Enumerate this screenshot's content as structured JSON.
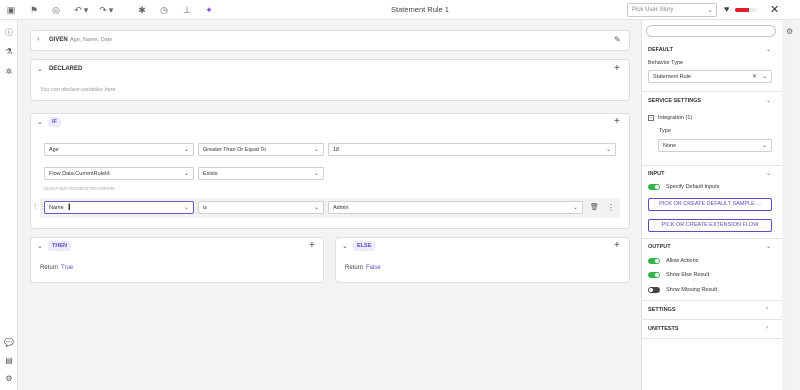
{
  "toolbar": {
    "title": "Statement Rule 1",
    "story_placeholder": "Pick User Story",
    "health_fraction": 0.65,
    "close_label": "✕"
  },
  "given": {
    "label": "GIVEN",
    "params": "Age, Name, Date"
  },
  "declared": {
    "label": "DECLARED",
    "hint": "You can declare variables here"
  },
  "if_block": {
    "label": "IF",
    "conditions": [
      {
        "field": "Age",
        "operator": "Greater Than Or Equal To",
        "value": "18"
      },
      {
        "field": "Flow Data.CurrentRuleId",
        "operator": "Exists",
        "guid": "01H57H82A7DS89GZ7RCHNK09K"
      },
      {
        "field": "Name",
        "operator": "is",
        "value": "Admin"
      }
    ]
  },
  "then_block": {
    "label": "THEN",
    "return_label": "Return",
    "return_value": "True"
  },
  "else_block": {
    "label": "ELSE",
    "return_label": "Return",
    "return_value": "False"
  },
  "right_panel": {
    "default": {
      "header": "DEFAULT",
      "behavior_label": "Behavior Type",
      "behavior_value": "Statement Rule"
    },
    "service_settings": {
      "header": "SERVICE SETTINGS",
      "integration_label": "Integration",
      "integration_count": "(1)",
      "type_label": "Type",
      "type_value": "None"
    },
    "input": {
      "header": "INPUT",
      "specify_label": "Specify Default Inputs",
      "specify_on": true,
      "btn_sample": "PICK OR CREATE DEFAULT SAMPLE ...",
      "btn_ext": "PICK OR CREATE EXTENSION FLOW"
    },
    "output": {
      "header": "OUTPUT",
      "toggles": [
        {
          "label": "Allow Actions",
          "on": true
        },
        {
          "label": "Show Else Result",
          "on": true
        },
        {
          "label": "Show Missing Result",
          "on": false
        }
      ]
    },
    "settings": {
      "header": "SETTINGS"
    },
    "unittests": {
      "header": "UNITTESTS"
    }
  },
  "colors": {
    "accent": "#5a4ec8",
    "toggle_on": "#36b34a",
    "health": "#e01d2a"
  }
}
